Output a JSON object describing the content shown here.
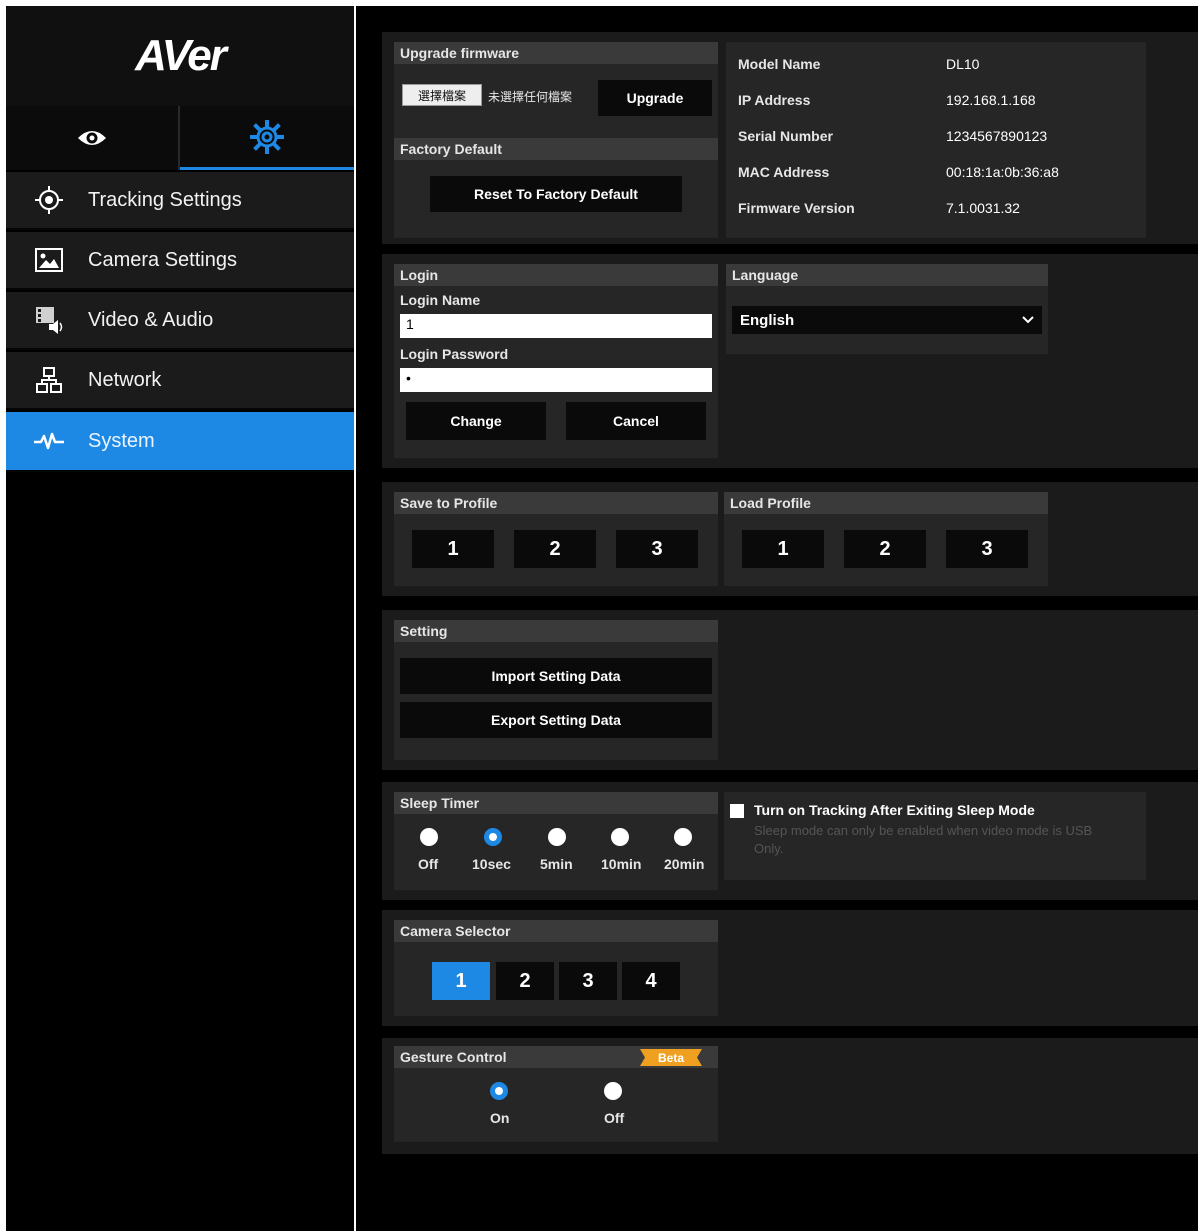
{
  "brand": {
    "logo_text": "AVer",
    "accent_color": "#1e88e5"
  },
  "mode_tabs": [
    {
      "icon": "eye-icon",
      "active": false
    },
    {
      "icon": "gear-icon",
      "active": true
    }
  ],
  "sidebar": {
    "items": [
      {
        "label": "Tracking Settings",
        "icon": "crosshair-icon"
      },
      {
        "label": "Camera Settings",
        "icon": "image-icon"
      },
      {
        "label": "Video & Audio",
        "icon": "video-audio-icon"
      },
      {
        "label": "Network",
        "icon": "network-icon"
      },
      {
        "label": "System",
        "icon": "pulse-icon",
        "active": true
      }
    ]
  },
  "firmware": {
    "header": "Upgrade firmware",
    "choose_file_label": "選擇檔案",
    "no_file_text": "未選擇任何檔案",
    "upgrade_label": "Upgrade"
  },
  "factory": {
    "header": "Factory Default",
    "reset_label": "Reset To Factory Default"
  },
  "device_info": {
    "rows": [
      {
        "label": "Model Name",
        "value": "DL10"
      },
      {
        "label": "IP Address",
        "value": "192.168.1.168"
      },
      {
        "label": "Serial Number",
        "value": "1234567890123"
      },
      {
        "label": "MAC Address",
        "value": "00:18:1a:0b:36:a8"
      },
      {
        "label": "Firmware Version",
        "value": "7.1.0031.32"
      }
    ]
  },
  "login": {
    "header": "Login",
    "name_label": "Login Name",
    "name_value": "1",
    "password_label": "Login Password",
    "password_value": "•",
    "change_label": "Change",
    "cancel_label": "Cancel"
  },
  "language": {
    "header": "Language",
    "selected": "English"
  },
  "save_profile": {
    "header": "Save to Profile",
    "buttons": [
      "1",
      "2",
      "3"
    ]
  },
  "load_profile": {
    "header": "Load Profile",
    "buttons": [
      "1",
      "2",
      "3"
    ]
  },
  "setting": {
    "header": "Setting",
    "import_label": "Import Setting Data",
    "export_label": "Export Setting Data"
  },
  "sleep_timer": {
    "header": "Sleep Timer",
    "options": [
      "Off",
      "10sec",
      "5min",
      "10min",
      "20min"
    ],
    "selected": "10sec"
  },
  "tracking_after_sleep": {
    "label": "Turn on Tracking After Exiting Sleep Mode",
    "note": "Sleep mode can only be enabled when video mode is USB Only.",
    "checked": false
  },
  "camera_selector": {
    "header": "Camera Selector",
    "buttons": [
      "1",
      "2",
      "3",
      "4"
    ],
    "selected": "1"
  },
  "gesture_control": {
    "header": "Gesture Control",
    "badge": "Beta",
    "badge_color": "#f0a020",
    "options": [
      "On",
      "Off"
    ],
    "selected": "On"
  }
}
